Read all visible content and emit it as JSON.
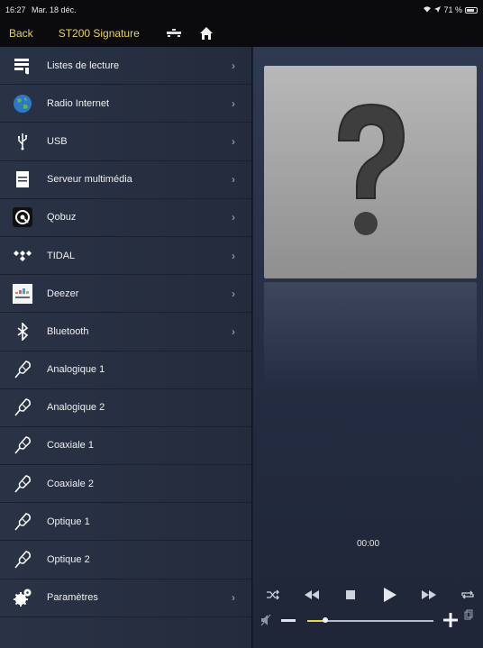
{
  "status": {
    "time": "16:27",
    "date": "Mar. 18 déc.",
    "battery": "71 %"
  },
  "nav": {
    "back_label": "Back",
    "title": "ST200 Signature"
  },
  "sidebar": {
    "items": [
      {
        "label": "Listes de lecture",
        "icon": "playlist-icon",
        "chevron": true
      },
      {
        "label": "Radio Internet",
        "icon": "globe-icon",
        "chevron": true
      },
      {
        "label": "USB",
        "icon": "usb-icon",
        "chevron": true
      },
      {
        "label": "Serveur multimédia",
        "icon": "server-icon",
        "chevron": true
      },
      {
        "label": "Qobuz",
        "icon": "qobuz-icon",
        "chevron": true
      },
      {
        "label": "TIDAL",
        "icon": "tidal-icon",
        "chevron": true
      },
      {
        "label": "Deezer",
        "icon": "deezer-icon",
        "chevron": true
      },
      {
        "label": "Bluetooth",
        "icon": "bluetooth-icon",
        "chevron": true
      },
      {
        "label": "Analogique 1",
        "icon": "connector-icon",
        "chevron": false
      },
      {
        "label": "Analogique 2",
        "icon": "connector-icon",
        "chevron": false
      },
      {
        "label": "Coaxiale 1",
        "icon": "connector-icon",
        "chevron": false
      },
      {
        "label": "Coaxiale 2",
        "icon": "connector-icon",
        "chevron": false
      },
      {
        "label": "Optique 1",
        "icon": "connector-icon",
        "chevron": false
      },
      {
        "label": "Optique 2",
        "icon": "connector-icon",
        "chevron": false
      },
      {
        "label": "Paramètres",
        "icon": "settings-gears-icon",
        "chevron": true
      }
    ]
  },
  "player": {
    "elapsed": "00:00",
    "volume_fraction": 0.14
  },
  "colors": {
    "accent": "#e8d35a",
    "sidebar_bg": "#2a3346",
    "main_bg": "#2f3950"
  }
}
